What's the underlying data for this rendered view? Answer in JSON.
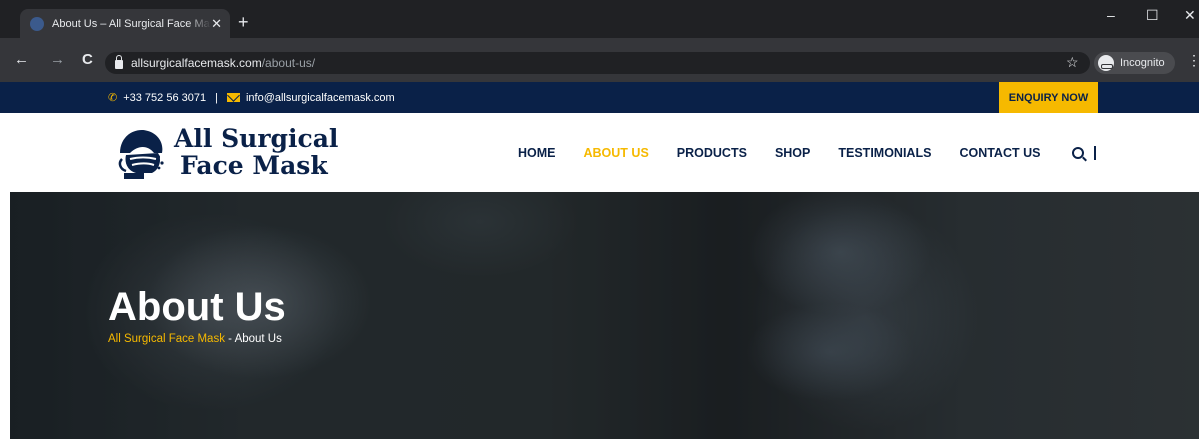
{
  "browser": {
    "tab_title": "About Us – All Surgical Face Mask – All Surgical Face Mask",
    "new_tab": "+",
    "tab_close": "✕",
    "url_host": "allsurgicalfacemask.com",
    "url_path": "/about-us/",
    "incognito_label": "Incognito",
    "back": "←",
    "forward": "→",
    "reload": "C",
    "star": "☆",
    "menu": "⋮",
    "minimize": "–",
    "maximize": "☐",
    "close": "✕"
  },
  "topbar": {
    "phone": "+33 752 56 3071",
    "separator": "|",
    "email": "info@allsurgicalfacemask.com",
    "enquiry_label": "ENQUIRY NOW"
  },
  "logo": {
    "line1": "All Surgical",
    "line2": "Face Mask"
  },
  "nav": {
    "items": [
      {
        "label": "HOME"
      },
      {
        "label": "ABOUT US"
      },
      {
        "label": "PRODUCTS"
      },
      {
        "label": "SHOP"
      },
      {
        "label": "TESTIMONIALS"
      },
      {
        "label": "CONTACT US"
      }
    ],
    "active_index": 1
  },
  "hero": {
    "title": "About Us",
    "breadcrumb_home": "All Surgical Face Mask",
    "breadcrumb_sep": " - ",
    "breadcrumb_current": "About Us"
  },
  "colors": {
    "navy": "#0a2148",
    "accent": "#f6b900"
  },
  "icons": {
    "phone": "phone-icon",
    "email": "mail-icon",
    "search": "search-icon",
    "lock": "lock-icon",
    "incognito": "incognito-icon"
  }
}
